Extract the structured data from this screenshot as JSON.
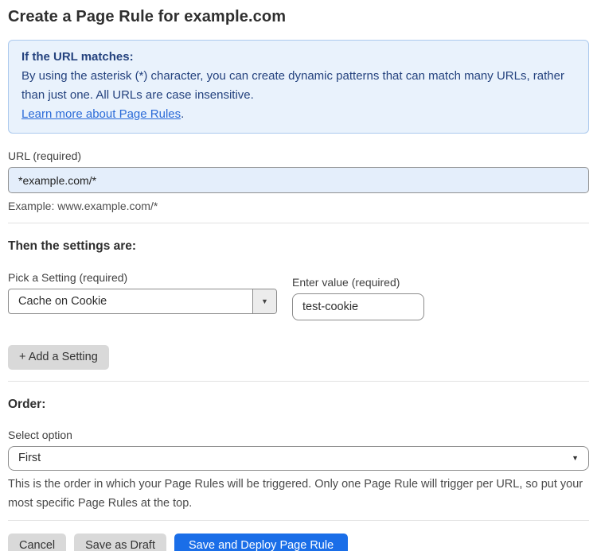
{
  "page": {
    "title": "Create a Page Rule for example.com"
  },
  "info_box": {
    "heading": "If the URL matches:",
    "body": "By using the asterisk (*) character, you can create dynamic patterns that can match many URLs, rather than just one. All URLs are case insensitive.",
    "link_label": "Learn more about Page Rules",
    "link_suffix": "."
  },
  "url_field": {
    "label": "URL (required)",
    "value": "*example.com/*",
    "example": "Example: www.example.com/*"
  },
  "settings_section": {
    "heading": "Then the settings are:",
    "setting_label": "Pick a Setting (required)",
    "setting_value": "Cache on Cookie",
    "value_label": "Enter value (required)",
    "value_value": "test-cookie",
    "add_button_label": "+ Add a Setting"
  },
  "order_section": {
    "heading": "Order:",
    "select_label": "Select option",
    "selected_option": "First",
    "help_text": "This is the order in which your Page Rules will be triggered. Only one Page Rule will trigger per URL, so put your most specific Page Rules at the top."
  },
  "actions": {
    "cancel_label": "Cancel",
    "save_draft_label": "Save as Draft",
    "save_deploy_label": "Save and Deploy Page Rule"
  },
  "icons": {
    "setting_dropdown": "chevron-down-icon",
    "order_dropdown": "chevron-down-icon",
    "arrow_glyph": "▼"
  },
  "colors": {
    "info_bg": "#e9f2fc",
    "info_border": "#abc9ee",
    "info_text": "#24427e",
    "link": "#2b6bd8",
    "url_input_bg": "#e4eefb",
    "primary_button": "#1a6ee8",
    "secondary_button": "#d9d9d9"
  }
}
